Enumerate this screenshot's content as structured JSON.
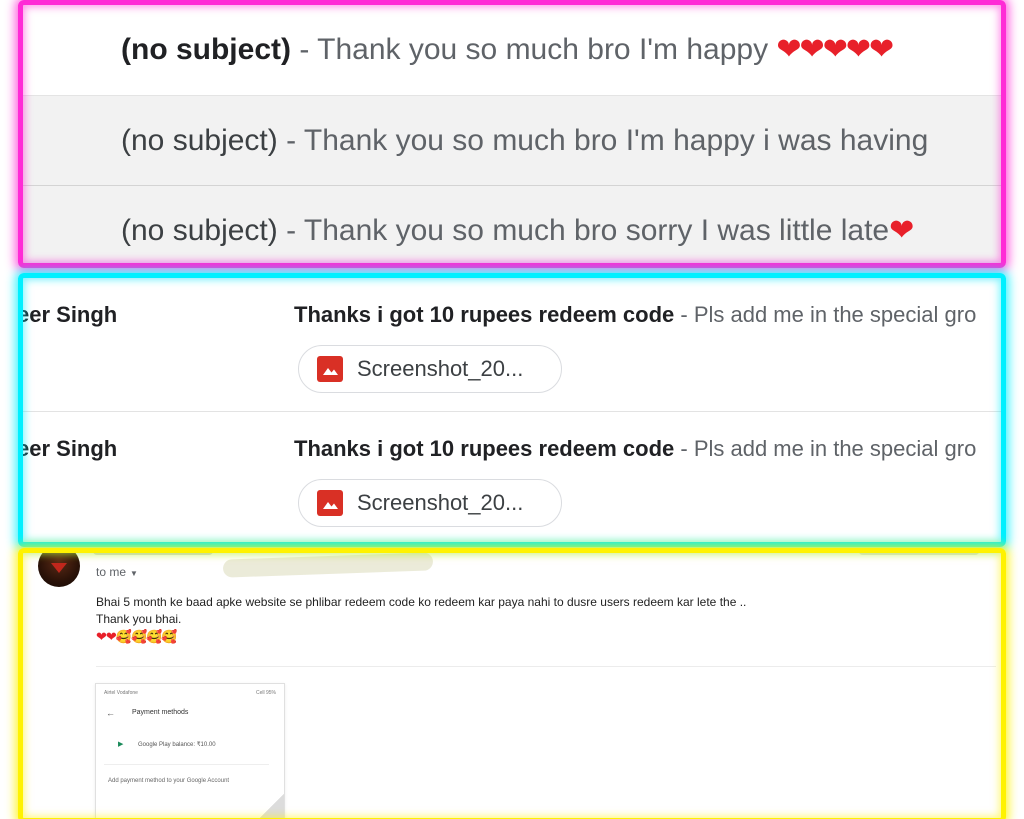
{
  "subject_rows": [
    {
      "subject": "(no subject)",
      "separator": " - ",
      "snippet": "Thank you so much bro I'm happy ",
      "emoji": "❤❤❤❤❤"
    },
    {
      "subject": "(no subject)",
      "separator": " - ",
      "snippet": "Thank you so much bro I'm happy i was having",
      "emoji": ""
    },
    {
      "subject": "(no subject)",
      "separator": " - ",
      "snippet": "Thank you so much bro sorry I was little late",
      "emoji": "❤"
    }
  ],
  "mail_rows": [
    {
      "sender": "eer Singh",
      "subject": "Thanks i got 10 rupees redeem code",
      "separator": " - ",
      "snippet": "Pls add me in the special gro",
      "attachment": "Screenshot_20..."
    },
    {
      "sender": "eer Singh",
      "subject": "Thanks i got 10 rupees redeem code",
      "separator": " - ",
      "snippet": "Pls add me in the special gro",
      "attachment": "Screenshot_20..."
    }
  ],
  "email": {
    "to": "to me",
    "body_line1": "Bhai 5 month ke baad apke website se phlibar redeem code ko redeem kar paya nahi to dusre users redeem kar lete the ..",
    "body_line2": "Thank you bhai.",
    "body_emoji": "❤❤🥰🥰🥰🥰",
    "attachment_preview": {
      "status_left": "Airtel Vodafone",
      "status_right": "Cell 95%",
      "title": "Payment methods",
      "balance": "Google Play balance: ₹10.00",
      "add_method": "Add payment method to your Google Account"
    }
  },
  "colors": {
    "magenta_frame": "#ff2bd6",
    "cyan_frame": "#00f0ff",
    "yellow_frame": "#fff200",
    "attachment_icon": "#d93025",
    "heart": "#e8202a"
  },
  "icons": {
    "attachment_icon": "image-icon",
    "heart": "heart-icon"
  }
}
